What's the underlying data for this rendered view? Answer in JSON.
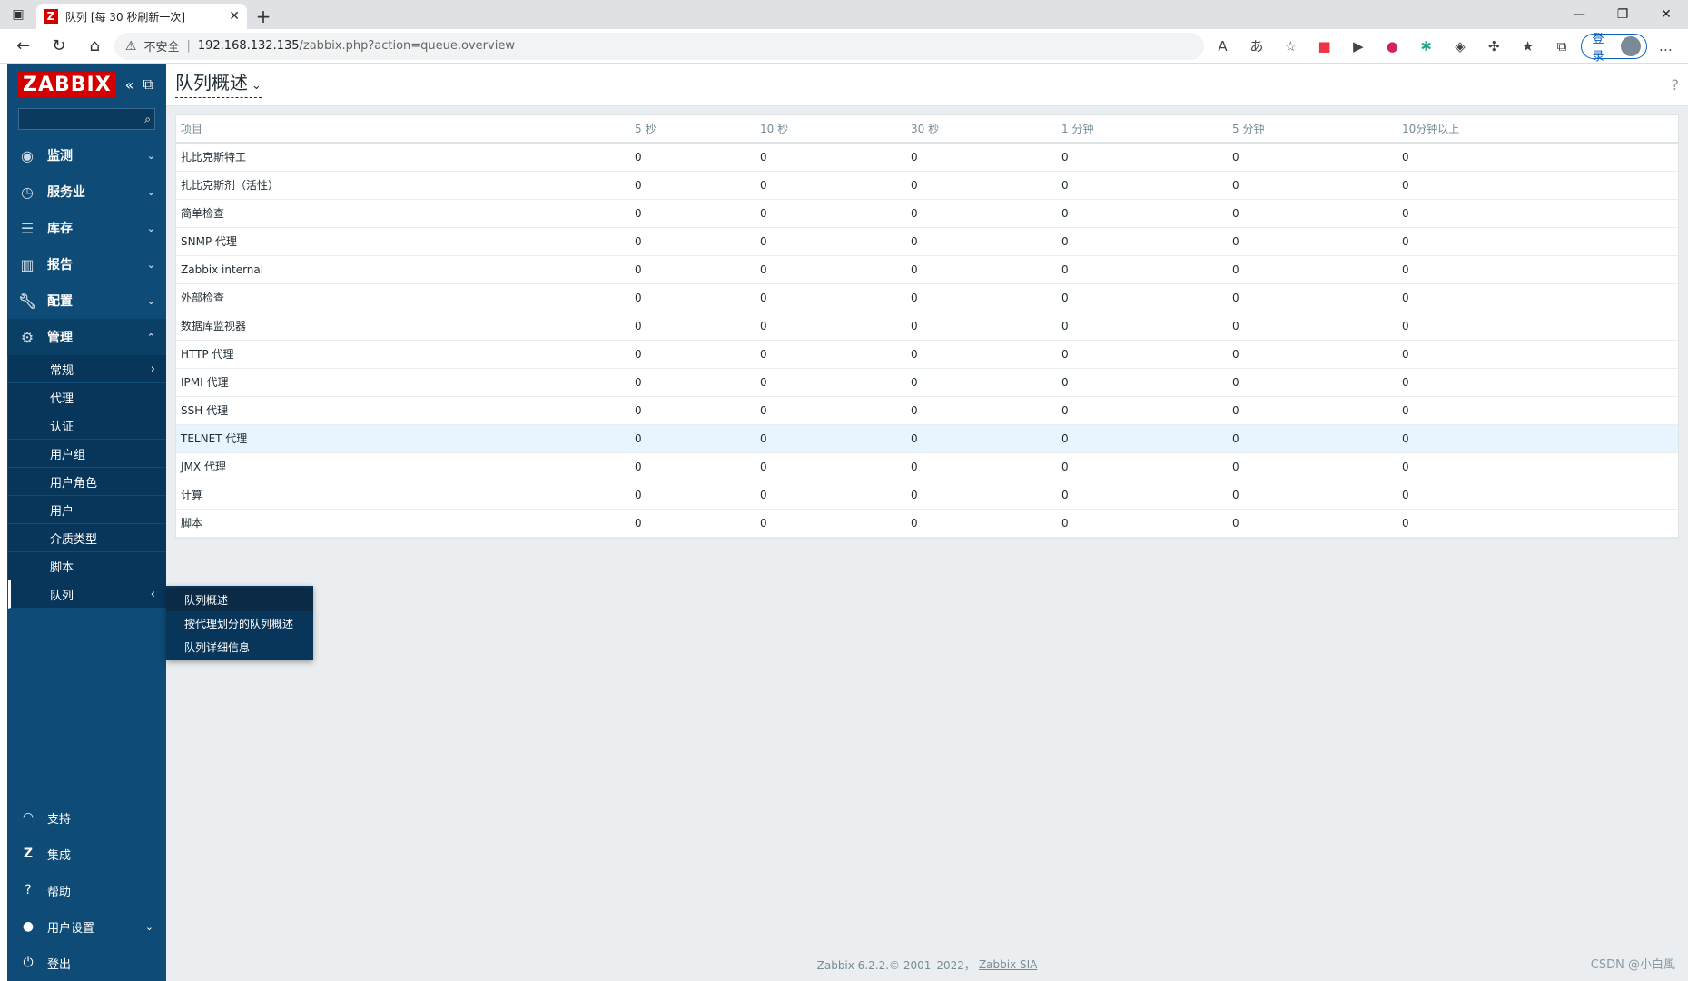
{
  "browser": {
    "tab_title": "队列 [每 30 秒刷新一次]",
    "tab_favicon": "Z",
    "url_warning": "不安全",
    "url_host": "192.168.132.135",
    "url_path": "/zabbix.php?action=queue.overview",
    "login_label": "登录"
  },
  "sidebar": {
    "logo": "ZABBIX",
    "menu": [
      {
        "label": "监测",
        "icon": "eye-icon"
      },
      {
        "label": "服务业",
        "icon": "clock-icon"
      },
      {
        "label": "库存",
        "icon": "list-icon"
      },
      {
        "label": "报告",
        "icon": "chart-icon"
      },
      {
        "label": "配置",
        "icon": "wrench-icon"
      },
      {
        "label": "管理",
        "icon": "gear-icon"
      }
    ],
    "admin_sub": [
      "常规",
      "代理",
      "认证",
      "用户组",
      "用户角色",
      "用户",
      "介质类型",
      "脚本",
      "队列"
    ],
    "footer": [
      {
        "label": "支持",
        "icon": "headset-icon"
      },
      {
        "label": "集成",
        "icon": "z-icon"
      },
      {
        "label": "帮助",
        "icon": "question-icon"
      },
      {
        "label": "用户设置",
        "icon": "user-icon"
      },
      {
        "label": "登出",
        "icon": "power-icon"
      }
    ]
  },
  "flyout": [
    "队列概述",
    "按代理划分的队列概述",
    "队列详细信息"
  ],
  "page": {
    "title": "队列概述",
    "help": "?"
  },
  "table": {
    "headers": [
      "项目",
      "5 秒",
      "10 秒",
      "30 秒",
      "1 分钟",
      "5 分钟",
      "10分钟以上"
    ],
    "rows": [
      {
        "name": "扎比克斯特工",
        "v": [
          "0",
          "0",
          "0",
          "0",
          "0",
          "0"
        ]
      },
      {
        "name": "扎比克斯剂（活性）",
        "v": [
          "0",
          "0",
          "0",
          "0",
          "0",
          "0"
        ]
      },
      {
        "name": "简单检查",
        "v": [
          "0",
          "0",
          "0",
          "0",
          "0",
          "0"
        ]
      },
      {
        "name": "SNMP 代理",
        "v": [
          "0",
          "0",
          "0",
          "0",
          "0",
          "0"
        ]
      },
      {
        "name": "Zabbix internal",
        "v": [
          "0",
          "0",
          "0",
          "0",
          "0",
          "0"
        ]
      },
      {
        "name": "外部检查",
        "v": [
          "0",
          "0",
          "0",
          "0",
          "0",
          "0"
        ]
      },
      {
        "name": "数据库监视器",
        "v": [
          "0",
          "0",
          "0",
          "0",
          "0",
          "0"
        ]
      },
      {
        "name": "HTTP 代理",
        "v": [
          "0",
          "0",
          "0",
          "0",
          "0",
          "0"
        ]
      },
      {
        "name": "IPMI 代理",
        "v": [
          "0",
          "0",
          "0",
          "0",
          "0",
          "0"
        ]
      },
      {
        "name": "SSH 代理",
        "v": [
          "0",
          "0",
          "0",
          "0",
          "0",
          "0"
        ]
      },
      {
        "name": "TELNET 代理",
        "v": [
          "0",
          "0",
          "0",
          "0",
          "0",
          "0"
        ]
      },
      {
        "name": "JMX 代理",
        "v": [
          "0",
          "0",
          "0",
          "0",
          "0",
          "0"
        ]
      },
      {
        "name": "计算",
        "v": [
          "0",
          "0",
          "0",
          "0",
          "0",
          "0"
        ]
      },
      {
        "name": "脚本",
        "v": [
          "0",
          "0",
          "0",
          "0",
          "0",
          "0"
        ]
      }
    ]
  },
  "footer": {
    "copyright": "Zabbix 6.2.2.© 2001–2022，",
    "company": "Zabbix SIA"
  },
  "watermark": "CSDN @小白風"
}
